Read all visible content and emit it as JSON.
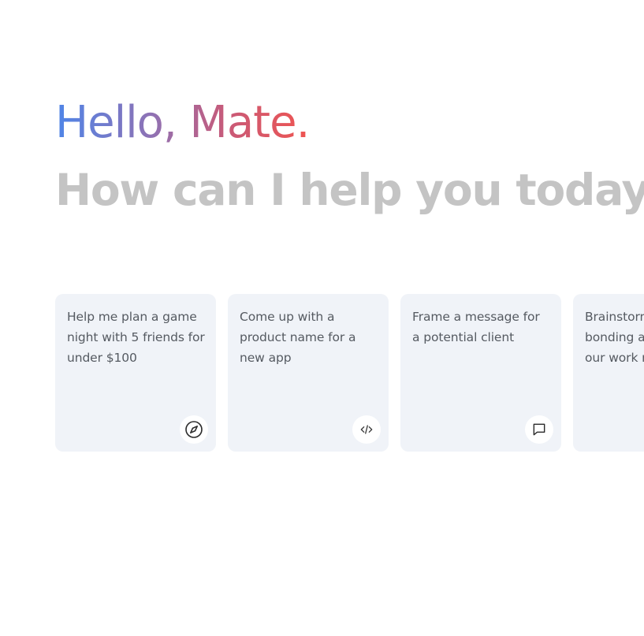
{
  "header": {
    "greeting": "Hello, Mate.",
    "subtitle": "How can I help you today?"
  },
  "colors": {
    "gradient_start": "#4f85e8",
    "gradient_mid": "#c95a78",
    "gradient_end": "#ef5450",
    "subtitle": "#c4c4c4",
    "card_background": "#f0f3f8"
  },
  "suggestions": [
    {
      "text": "Help me plan a game night with 5 friends for under $100",
      "icon": "compass-icon"
    },
    {
      "text": "Come up with a product name for a new app",
      "icon": "code-icon"
    },
    {
      "text": "Frame a message for a potential client",
      "icon": "message-icon"
    },
    {
      "text": "Brainstorm team bonding activities for our work retreat",
      "icon": "lightbulb-icon"
    }
  ]
}
